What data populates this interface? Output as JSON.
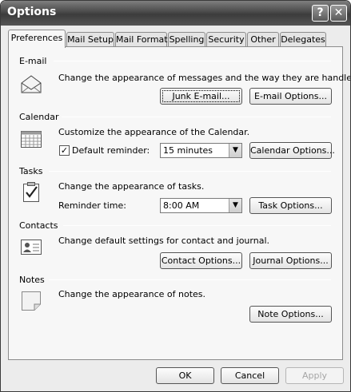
{
  "window": {
    "title": "Options"
  },
  "title_buttons": {
    "help": "?",
    "close": "✕"
  },
  "tabs": [
    {
      "label": "Preferences"
    },
    {
      "label": "Mail Setup"
    },
    {
      "label": "Mail Format"
    },
    {
      "label": "Spelling"
    },
    {
      "label": "Security"
    },
    {
      "label": "Other"
    },
    {
      "label": "Delegates"
    }
  ],
  "email": {
    "heading": "E-mail",
    "description": "Change the appearance of messages and the way they are handled.",
    "junk_button": "Junk E-mail...",
    "options_button": "E-mail Options..."
  },
  "calendar": {
    "heading": "Calendar",
    "description": "Customize the appearance of the Calendar.",
    "reminder_label": "Default reminder:",
    "reminder_checked": true,
    "reminder_value": "15 minutes",
    "options_button": "Calendar Options..."
  },
  "tasks": {
    "heading": "Tasks",
    "description": "Change the appearance of tasks.",
    "reminder_label": "Reminder time:",
    "reminder_value": "8:00 AM",
    "options_button": "Task Options..."
  },
  "contacts": {
    "heading": "Contacts",
    "description": "Change default settings for contact and journal.",
    "contact_button": "Contact Options...",
    "journal_button": "Journal Options..."
  },
  "notes": {
    "heading": "Notes",
    "description": "Change the appearance of notes.",
    "options_button": "Note Options..."
  },
  "footer": {
    "ok": "OK",
    "cancel": "Cancel",
    "apply": "Apply"
  }
}
